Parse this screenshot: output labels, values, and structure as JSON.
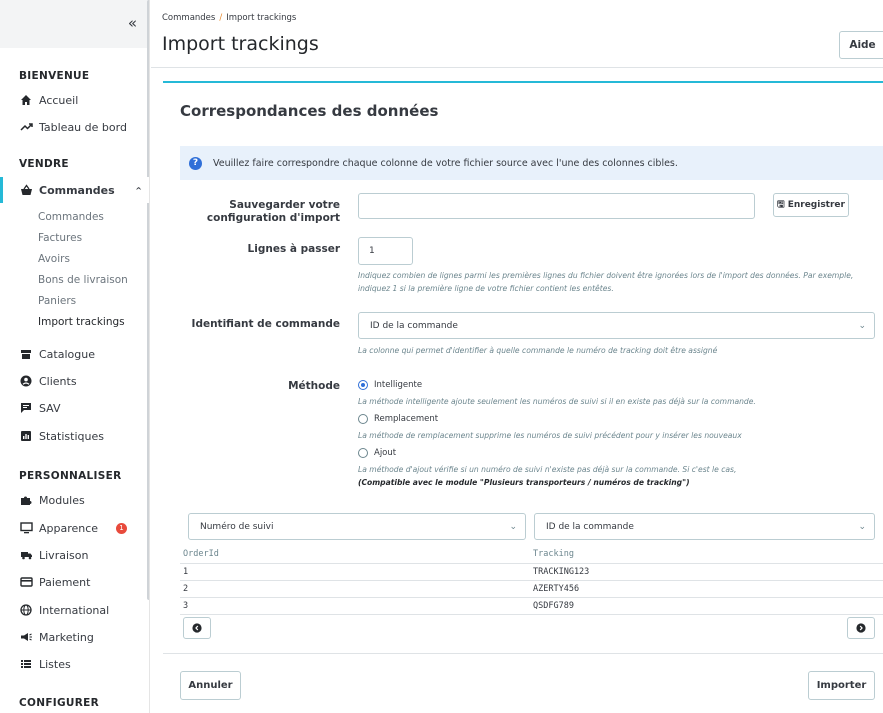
{
  "sidebar": {
    "sections": [
      {
        "title": "BIENVENUE"
      },
      {
        "title": "VENDRE"
      },
      {
        "title": "PERSONNALISER"
      },
      {
        "title": "CONFIGURER"
      }
    ],
    "welcome_items": [
      {
        "label": "Accueil",
        "icon": "home-icon"
      },
      {
        "label": "Tableau de bord",
        "icon": "trending-icon"
      }
    ],
    "commandes": {
      "label": "Commandes",
      "icon": "basket-icon"
    },
    "commandes_sub": [
      "Commandes",
      "Factures",
      "Avoirs",
      "Bons de livraison",
      "Paniers",
      "Import trackings"
    ],
    "sell_items": [
      {
        "label": "Catalogue",
        "icon": "store-icon"
      },
      {
        "label": "Clients",
        "icon": "account-icon"
      },
      {
        "label": "SAV",
        "icon": "chat-icon"
      },
      {
        "label": "Statistiques",
        "icon": "chart-icon"
      }
    ],
    "custom_items": [
      {
        "label": "Modules",
        "icon": "puzzle-icon"
      },
      {
        "label": "Apparence",
        "icon": "desktop-icon",
        "badge": "1"
      },
      {
        "label": "Livraison",
        "icon": "truck-icon"
      },
      {
        "label": "Paiement",
        "icon": "card-icon"
      },
      {
        "label": "International",
        "icon": "globe-icon"
      },
      {
        "label": "Marketing",
        "icon": "megaphone-icon"
      },
      {
        "label": "Listes",
        "icon": "list-icon"
      }
    ]
  },
  "header": {
    "breadcrumb_parent": "Commandes",
    "breadcrumb_sep": "/",
    "breadcrumb_current": "Import trackings",
    "title": "Import trackings",
    "help_label": "Aide"
  },
  "card": {
    "title": "Correspondances des données",
    "alert": "Veuillez faire correspondre chaque colonne de votre fichier source avec l'une des colonnes cibles.",
    "save_config": {
      "label": "Sauvegarder votre configuration d'import",
      "value": "",
      "button": "Enregistrer"
    },
    "skip_lines": {
      "label": "Lignes à passer",
      "value": "1",
      "help": "Indiquez combien de lignes parmi les premières lignes du fichier doivent être ignorées lors de l'import des données. Par exemple, indiquez 1 si la première ligne de votre fichier contient les entêtes."
    },
    "order_id": {
      "label": "Identifiant de commande",
      "value": "ID de la commande",
      "help": "La colonne qui permet d'identifier à quelle commande le numéro de tracking doit être assigné"
    },
    "method": {
      "label": "Méthode",
      "options": [
        {
          "label": "Intelligente",
          "checked": true,
          "help": "La méthode intelligente ajoute seulement les numéros de suivi si il en existe pas déjà sur la commande."
        },
        {
          "label": "Remplacement",
          "checked": false,
          "help": "La méthode de remplacement supprime les numéros de suivi précédent pour y insérer les nouveaux"
        },
        {
          "label": "Ajout",
          "checked": false,
          "help": "La méthode d'ajout vérifie si un numéro de suivi n'existe pas déjà sur la commande. Si c'est le cas,",
          "help2": "(Compatible avec le module \"Plusieurs transporteurs / numéros de tracking\")"
        }
      ]
    },
    "mapping": {
      "col1": "Numéro de suivi",
      "col2": "ID de la commande"
    },
    "preview": {
      "headers": [
        "OrderId",
        "Tracking"
      ],
      "rows": [
        [
          "1",
          "TRACKING123"
        ],
        [
          "2",
          "AZERTY456"
        ],
        [
          "3",
          "QSDFG789"
        ]
      ]
    },
    "cancel_label": "Annuler",
    "import_label": "Importer"
  }
}
